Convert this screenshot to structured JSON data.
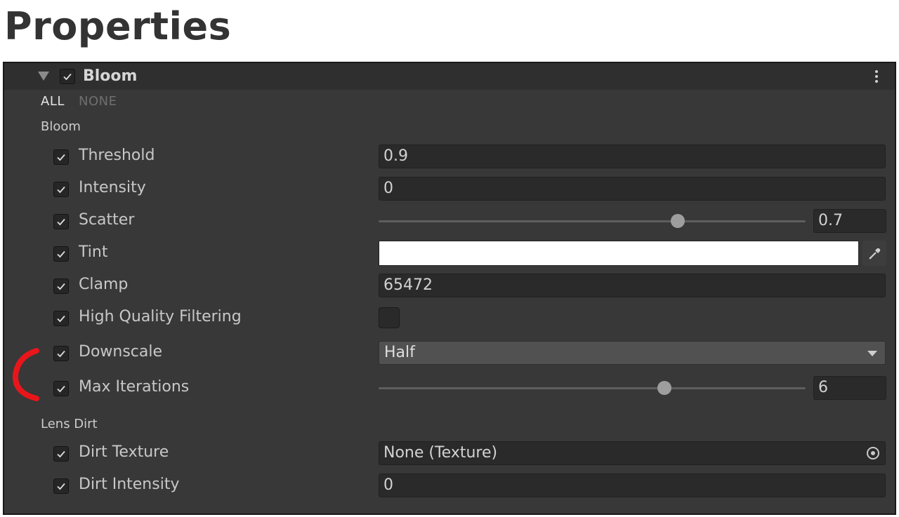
{
  "page": {
    "title": "Properties"
  },
  "header": {
    "title": "Bloom",
    "enabled": true
  },
  "toggles": {
    "all": "ALL",
    "none": "NONE"
  },
  "sections": {
    "bloom": "Bloom",
    "lens_dirt": "Lens Dirt"
  },
  "rows": {
    "threshold": {
      "label": "Threshold",
      "value": "0.9"
    },
    "intensity": {
      "label": "Intensity",
      "value": "0"
    },
    "scatter": {
      "label": "Scatter",
      "value": "0.7",
      "slider_fraction": 0.7
    },
    "tint": {
      "label": "Tint",
      "color": "#ffffff"
    },
    "clamp": {
      "label": "Clamp",
      "value": "65472"
    },
    "hq_filtering": {
      "label": "High Quality Filtering",
      "checked": false
    },
    "downscale": {
      "label": "Downscale",
      "value": "Half"
    },
    "max_iterations": {
      "label": "Max Iterations",
      "value": "6",
      "slider_fraction": 0.67
    },
    "dirt_texture": {
      "label": "Dirt Texture",
      "value": "None (Texture)"
    },
    "dirt_intensity": {
      "label": "Dirt Intensity",
      "value": "0"
    }
  },
  "colors": {
    "panel_bg": "#383838",
    "field_bg": "#2a2a2a",
    "annotation": "#e8161b"
  },
  "icons": {
    "foldout": "triangle-down-icon",
    "checkbox": "check-icon",
    "menu": "kebab-menu-icon",
    "eyedropper": "eyedropper-icon",
    "object_picker": "target-icon",
    "dropdown": "chevron-down-icon"
  }
}
